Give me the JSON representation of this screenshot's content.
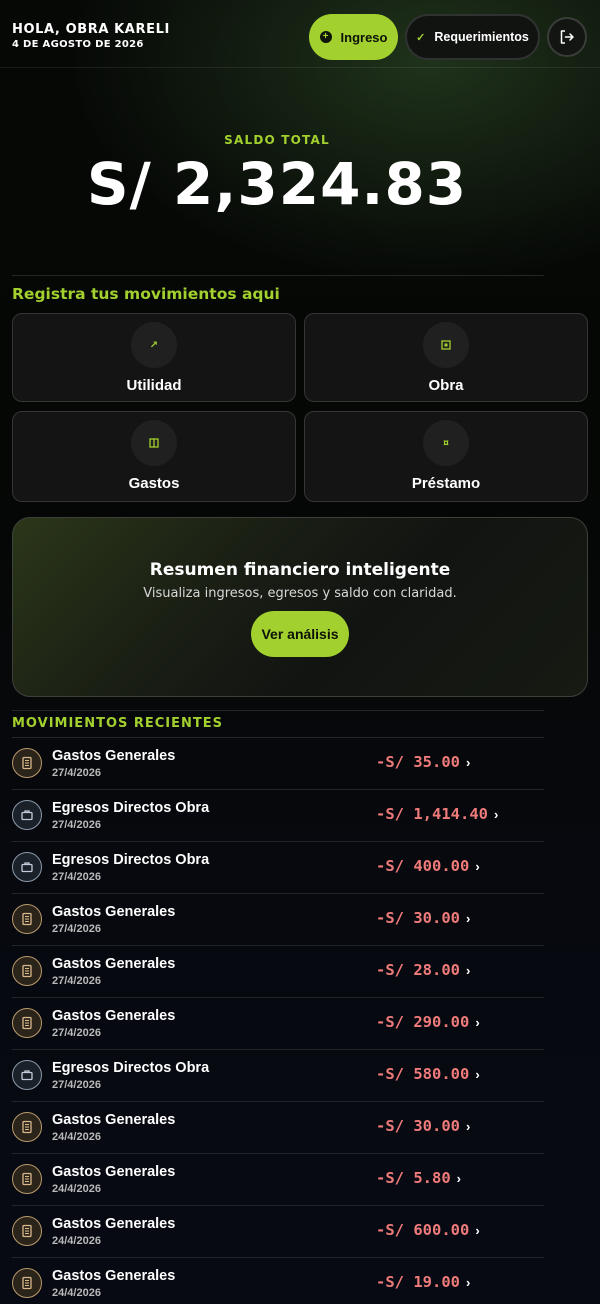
{
  "header": {
    "greeting": "HOLA, OBRA KARELI",
    "date": "4 DE AGOSTO DE 2026",
    "ingreso_label": "Ingreso",
    "requerimientos_label": "Requerimientos"
  },
  "balance": {
    "label": "SALDO TOTAL",
    "value": "S/ 2,324.83"
  },
  "register": {
    "title": "Registra tus movimientos aqui",
    "actions": [
      {
        "label": "Utilidad",
        "icon": "arrow-up-right-icon"
      },
      {
        "label": "Obra",
        "icon": "building-icon"
      },
      {
        "label": "Gastos",
        "icon": "book-icon"
      },
      {
        "label": "Préstamo",
        "icon": "loan-icon"
      }
    ]
  },
  "summary": {
    "title": "Resumen financiero inteligente",
    "subtitle": "Visualiza ingresos, egresos y saldo con claridad.",
    "button_label": "Ver análisis"
  },
  "recent": {
    "title": "MOVIMIENTOS RECIENTES",
    "items": [
      {
        "name": "Gastos Generales",
        "date": "27/4/2026",
        "amount": "-S/ 35.00",
        "icon": "receipt-icon"
      },
      {
        "name": "Egresos Directos Obra",
        "date": "27/4/2026",
        "amount": "-S/ 1,414.40",
        "icon": "briefcase-icon"
      },
      {
        "name": "Egresos Directos Obra",
        "date": "27/4/2026",
        "amount": "-S/ 400.00",
        "icon": "briefcase-icon"
      },
      {
        "name": "Gastos Generales",
        "date": "27/4/2026",
        "amount": "-S/ 30.00",
        "icon": "receipt-icon"
      },
      {
        "name": "Gastos Generales",
        "date": "27/4/2026",
        "amount": "-S/ 28.00",
        "icon": "receipt-icon"
      },
      {
        "name": "Gastos Generales",
        "date": "27/4/2026",
        "amount": "-S/ 290.00",
        "icon": "receipt-icon"
      },
      {
        "name": "Egresos Directos Obra",
        "date": "27/4/2026",
        "amount": "-S/ 580.00",
        "icon": "briefcase-icon"
      },
      {
        "name": "Gastos Generales",
        "date": "24/4/2026",
        "amount": "-S/ 30.00",
        "icon": "receipt-icon"
      },
      {
        "name": "Gastos Generales",
        "date": "24/4/2026",
        "amount": "-S/ 5.80",
        "icon": "receipt-icon"
      },
      {
        "name": "Gastos Generales",
        "date": "24/4/2026",
        "amount": "-S/ 600.00",
        "icon": "receipt-icon"
      },
      {
        "name": "Gastos Generales",
        "date": "24/4/2026",
        "amount": "-S/ 19.00",
        "icon": "receipt-icon"
      }
    ]
  },
  "colors": {
    "accent": "#a2d02e",
    "negative": "#f07b7b"
  }
}
